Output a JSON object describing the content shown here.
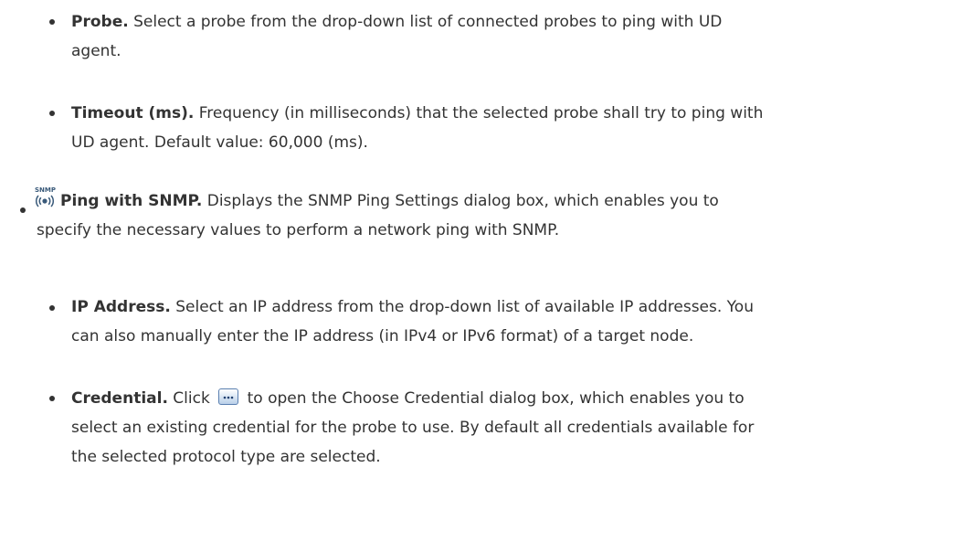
{
  "items": {
    "probe": {
      "term": "Probe.",
      "line1": " Select a probe from the drop-down list of connected probes to ping with UD",
      "line2": "agent."
    },
    "timeout": {
      "term": "Timeout (ms).",
      "line1": " Frequency (in milliseconds) that the selected probe shall try to ping with",
      "line2": "UD agent. Default value: 60,000 (ms)."
    },
    "ping_snmp": {
      "icon": "snmp-ping-icon",
      "icon_text": "SNMP",
      "term": "Ping with SNMP.",
      "line1": " Displays the SNMP Ping Settings dialog box, which enables you to",
      "line2": "specify the necessary values to perform a network ping with SNMP."
    },
    "ip_address": {
      "term": "IP Address.",
      "line1": " Select an IP address from the drop-down list of available IP addresses. You",
      "line2": "can also manually enter the IP address (in IPv4 or IPv6 format) of a target node."
    },
    "credential": {
      "term": "Credential.",
      "line1a": " Click ",
      "button_icon": "ellipsis-button-icon",
      "line1b": " to open the Choose Credential dialog box, which enables you to",
      "line2": "select an existing credential for the probe to use. By default all credentials available for",
      "line3": "the selected protocol type are selected."
    }
  }
}
